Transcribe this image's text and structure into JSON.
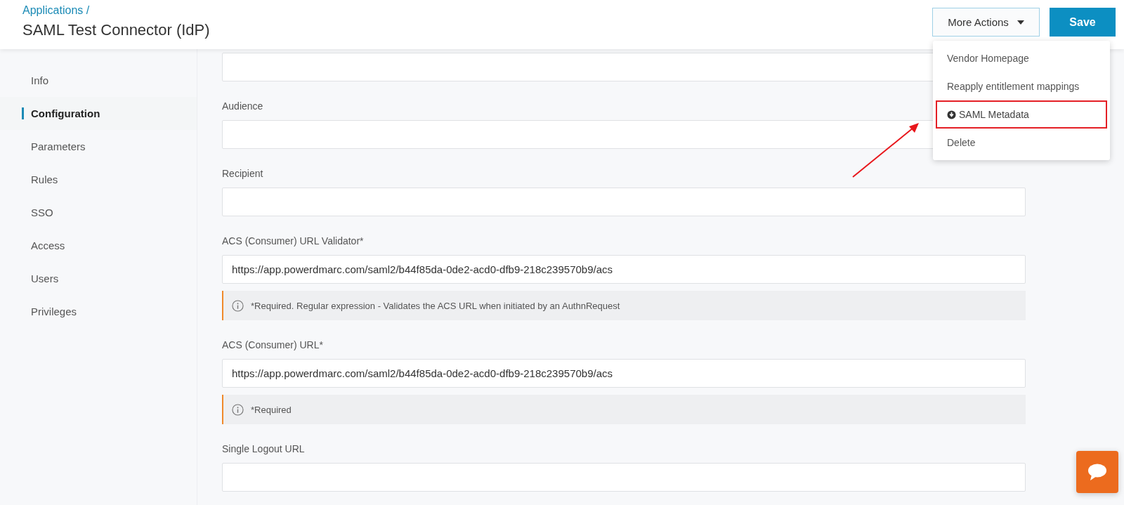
{
  "breadcrumb": "Applications /",
  "title": "SAML Test Connector (IdP)",
  "buttons": {
    "more_actions": "More Actions",
    "save": "Save"
  },
  "menu": {
    "open": true,
    "items": [
      {
        "label": "Vendor Homepage",
        "has_icon": false,
        "highlighted": false
      },
      {
        "label": "Reapply entitlement mappings",
        "has_icon": false,
        "highlighted": false
      },
      {
        "label": "SAML Metadata",
        "has_icon": true,
        "highlighted": true
      },
      {
        "label": "Delete",
        "has_icon": false,
        "highlighted": false
      }
    ]
  },
  "sidebar": {
    "items": [
      {
        "label": "Info",
        "selected": false
      },
      {
        "label": "Configuration",
        "selected": true
      },
      {
        "label": "Parameters",
        "selected": false
      },
      {
        "label": "Rules",
        "selected": false
      },
      {
        "label": "SSO",
        "selected": false
      },
      {
        "label": "Access",
        "selected": false
      },
      {
        "label": "Users",
        "selected": false
      },
      {
        "label": "Privileges",
        "selected": false
      }
    ]
  },
  "fields": [
    {
      "kind": "text"
    },
    {
      "kind": "text",
      "label": "Audience"
    },
    {
      "kind": "text",
      "label": "Recipient"
    },
    {
      "kind": "text",
      "label": "ACS (Consumer) URL Validator*",
      "value": "https://app.powerdmarc.com/saml2/b44f85da-0de2-acd0-dfb9-218c239570b9/acs",
      "note": "*Required. Regular expression - Validates the ACS URL when initiated by an AuthnRequest"
    },
    {
      "kind": "text",
      "label": "ACS (Consumer) URL*",
      "value": "https://app.powerdmarc.com/saml2/b44f85da-0de2-acd0-dfb9-218c239570b9/acs",
      "note": "*Required"
    },
    {
      "kind": "text",
      "label": "Single Logout URL"
    }
  ]
}
